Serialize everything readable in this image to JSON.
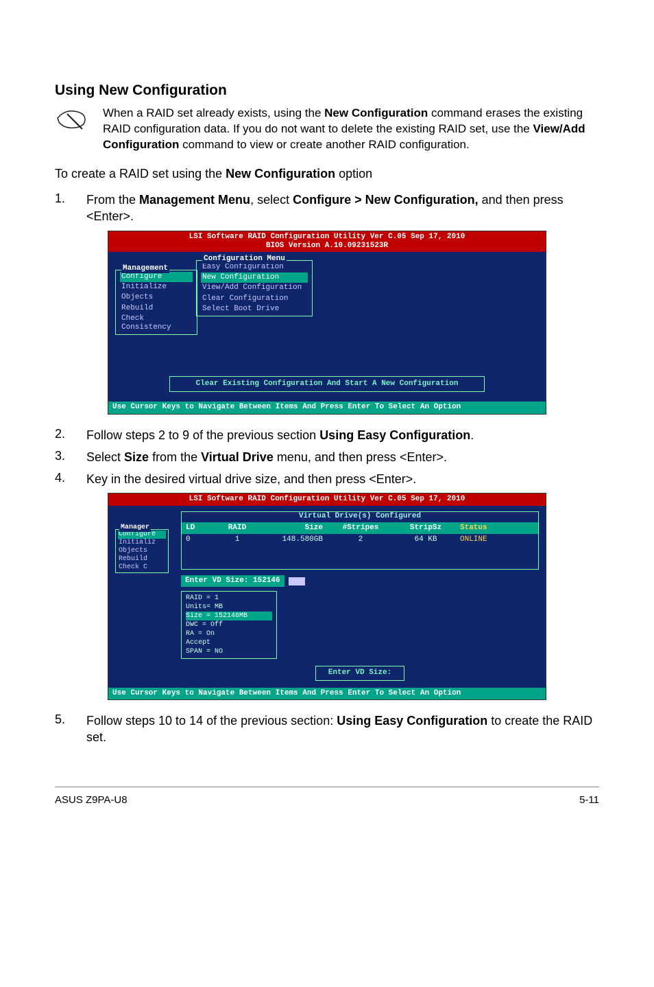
{
  "section_title": "Using New Configuration",
  "note": {
    "text_parts": {
      "p1": "When a RAID set already exists, using the ",
      "b1": "New Configuration",
      "p2": " command erases the existing RAID configuration data. If you do not want to delete the existing RAID set, use the ",
      "b2": "View/Add Configuration",
      "p3": " command to view or create another RAID configuration."
    }
  },
  "intro": {
    "p1": "To create a RAID set using the ",
    "b1": "New Configuration",
    "p2": " option"
  },
  "steps": {
    "s1": {
      "num": "1.",
      "p1": "From the ",
      "b1": "Management Menu",
      "p2": ", select ",
      "b2": "Configure > New Configuration,",
      "p3": " and then press <Enter>."
    },
    "s2": {
      "num": "2.",
      "p1": "Follow steps 2 to 9 of the previous section ",
      "b1": "Using Easy Configuration",
      "p2": "."
    },
    "s3": {
      "num": "3.",
      "p1": "Select ",
      "b1": "Size",
      "p2": " from the ",
      "b2": "Virtual Drive",
      "p3": " menu, and then press <Enter>."
    },
    "s4": {
      "num": "4.",
      "p1": "Key in the desired virtual drive size, and then press <Enter>."
    },
    "s5": {
      "num": "5.",
      "p1": "Follow steps 10 to 14 of the previous section: ",
      "b1": "Using Easy Configuration",
      "p2": " to create the RAID set."
    }
  },
  "bios1": {
    "header_line1": "LSI Software RAID Configuration Utility Ver C.05 Sep 17, 2010",
    "header_line2": "BIOS Version   A.10.09231523R",
    "mgmt_label": "Management",
    "mgmt_items": [
      "Configure",
      "Initialize",
      "Objects",
      "Rebuild",
      "Check Consistency"
    ],
    "conf_label": "Configuration Menu",
    "conf_items": [
      "Easy Configuration",
      "New Configuration",
      "View/Add Configuration",
      "Clear Configuration",
      "Select Boot Drive"
    ],
    "msg": "Clear Existing Configuration And Start A New Configuration",
    "footer": "Use Cursor Keys to Navigate Between Items And Press Enter To Select An Option"
  },
  "bios2": {
    "header_line1": "LSI Software RAID Configuration Utility Ver C.05 Sep 17, 2010",
    "vd_title": "Virtual Drive(s) Configured",
    "cols": {
      "ld": "LD",
      "raid": "RAID",
      "size": "Size",
      "stripes": "#Stripes",
      "stripsz": "StripSz",
      "status": "Status"
    },
    "row": {
      "ld": "0",
      "raid": "1",
      "size": "148.580GB",
      "stripes": "2",
      "stripsz": "64 KB",
      "status": "ONLINE"
    },
    "mgmt_label": "Manager",
    "mgmt_items": [
      "Configure",
      "Initializ",
      "Objects",
      "Rebuild",
      "Check C"
    ],
    "enter_vd_label": "Enter VD Size:",
    "enter_vd_value": "152146",
    "cfg_lines": {
      "l1": "RAID = 1",
      "l2": "Units= MB",
      "l3": "Size = 152146MB",
      "l4": "DWC  = Off",
      "l5": "RA   = On",
      "l6": "Accept",
      "l7": "SPAN = NO"
    },
    "prompt": "Enter VD Size:",
    "footer": "Use Cursor Keys to Navigate Between Items And Press Enter To Select An Option"
  },
  "footer": {
    "left": "ASUS Z9PA-U8",
    "right": "5-11"
  }
}
